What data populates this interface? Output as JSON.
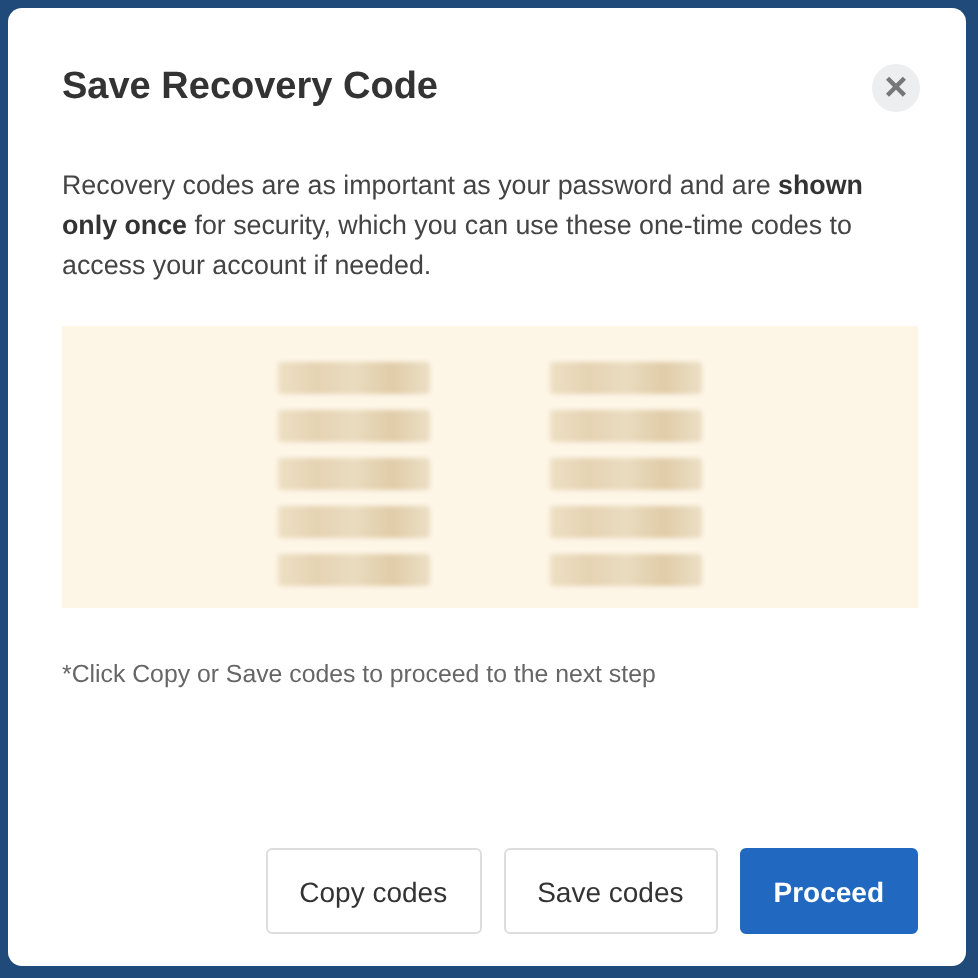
{
  "dialog": {
    "title": "Save Recovery Code",
    "close_icon": "×",
    "description": "Recovery codes are as important as your password and are **shown only once** for security, which you can use these one-time codes to access your account if needed.",
    "note": "*Click Copy or Save codes to proceed to the next step",
    "buttons": [
      {
        "label": "Copy codes",
        "kind": "secondary"
      },
      {
        "label": "Save codes",
        "kind": "secondary"
      },
      {
        "label": "Proceed",
        "kind": "primary"
      }
    ]
  }
}
